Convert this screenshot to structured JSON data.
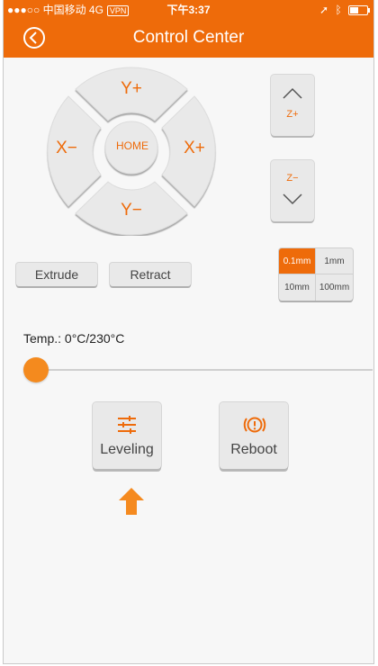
{
  "status_bar": {
    "left": "●●●○○ 中国移动  4G",
    "vpn": "VPN",
    "time": "下午3:37",
    "right_icons": "location-arrow-icon, bluetooth-icon, battery-icon"
  },
  "header": {
    "title": "Control Center",
    "back_icon": "back-circle-icon"
  },
  "dpad": {
    "up": "Y+",
    "down": "Y−",
    "left": "X−",
    "right": "X+",
    "home": "HOME"
  },
  "z": {
    "up": "Z+",
    "down": "Z−"
  },
  "actions": {
    "extrude": "Extrude",
    "retract": "Retract"
  },
  "steps": {
    "options": [
      "0.1mm",
      "1mm",
      "10mm",
      "100mm"
    ],
    "selected": "0.1mm"
  },
  "temperature": {
    "label": "Temp.: 0°C/230°C",
    "value": 0,
    "max": 230
  },
  "buttons": {
    "leveling": "Leveling",
    "reboot": "Reboot"
  },
  "colors": {
    "accent": "#ee6b0a",
    "background": "#f7f7f7",
    "button": "#e9e9e9"
  }
}
